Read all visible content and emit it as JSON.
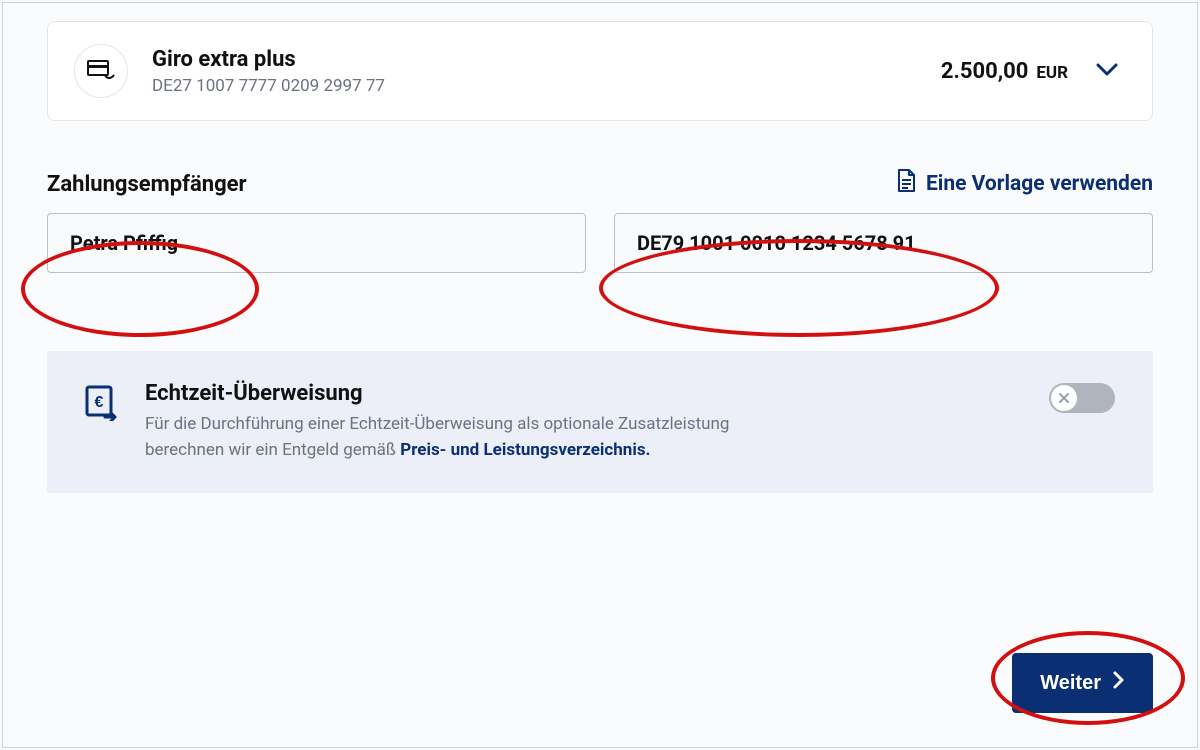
{
  "account": {
    "name": "Giro extra plus",
    "iban": "DE27 1007 7777 0209 2997 77",
    "balance": "2.500,00",
    "currency": "EUR"
  },
  "recipient": {
    "section_label": "Zahlungsempfänger",
    "template_link": "Eine Vorlage verwenden",
    "name_value": "Petra Pfiffig",
    "iban_value": "DE79 1001 0010 1234 5678 91"
  },
  "realtime": {
    "title": "Echtzeit-Überweisung",
    "desc_pre": "Für die Durchführung einer Echtzeit-Überweisung als optionale Zusatzleistung berechnen wir ein Entgeld gemäß ",
    "desc_link": "Preis- und Leistungsverzeichnis.",
    "enabled": false
  },
  "actions": {
    "continue": "Weiter"
  },
  "colors": {
    "primary": "#0a2f73",
    "annotation": "#d31010"
  }
}
